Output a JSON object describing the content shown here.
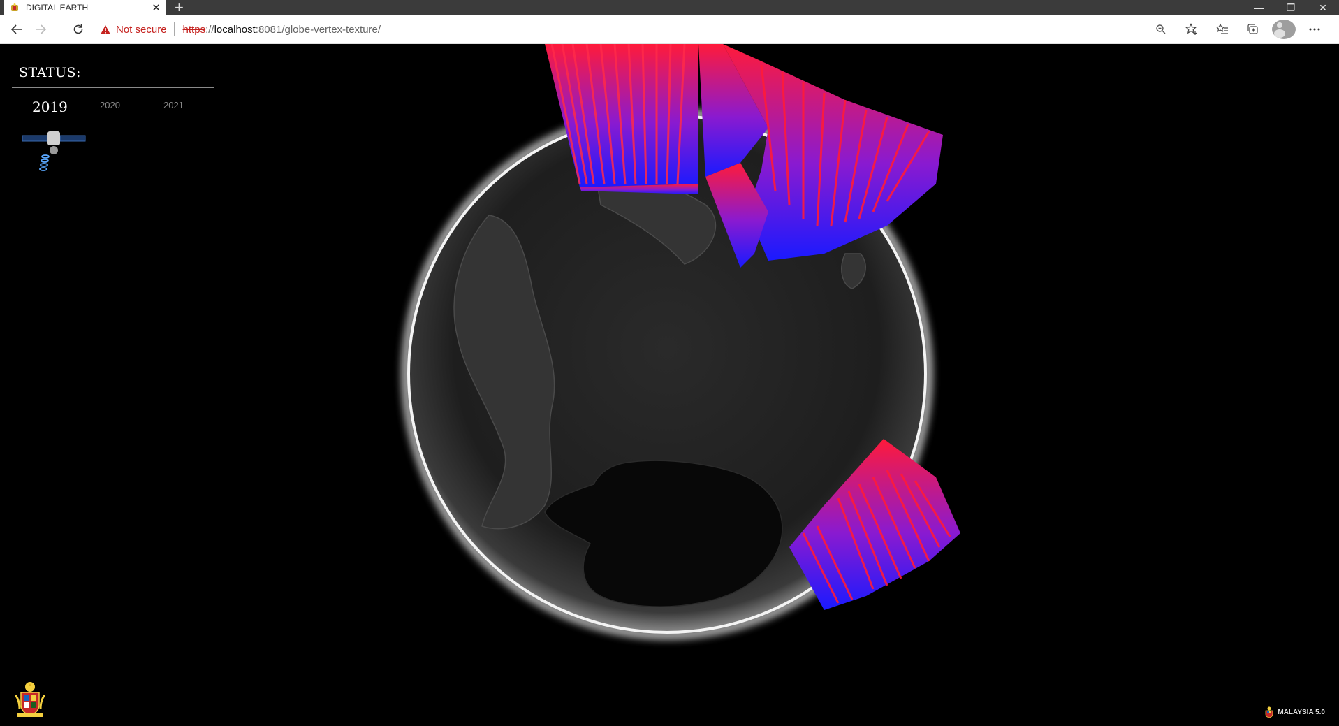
{
  "browser": {
    "tab_title": "DIGITAL EARTH",
    "tab_close": "✕",
    "new_tab": "+",
    "security_label": "Not secure",
    "url_scheme": "https",
    "url_sep": "://",
    "url_host": "localhost",
    "url_rest": ":8081/globe-vertex-texture/",
    "window_controls": [
      "—",
      "❐",
      "✕"
    ]
  },
  "panel": {
    "status_label": "STATUS:",
    "years": [
      "2019",
      "2020",
      "2021"
    ],
    "active_year": "2019"
  },
  "footer": {
    "brand": "MALAYSIA 5.0"
  },
  "icons": {
    "back": "back-arrow-icon",
    "forward": "forward-arrow-icon",
    "reload": "reload-icon",
    "warning": "warning-icon",
    "zoom": "zoom-icon",
    "favorite": "star-add-icon",
    "favorites": "favorites-list-icon",
    "collections": "collections-icon",
    "profile": "profile-avatar-icon",
    "menu": "more-menu-icon",
    "satellite": "satellite-icon",
    "crest": "malaysia-crest-icon"
  },
  "colors": {
    "bar_top": "#ff1a3a",
    "bar_base": "#1a1aff",
    "globe_glow": "#ffffff",
    "security_red": "#c5221f"
  }
}
